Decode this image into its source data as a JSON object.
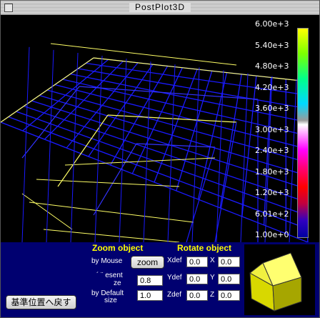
{
  "window": {
    "title": "PostPlot3D"
  },
  "colorbar": {
    "labels": [
      "6.00e+3",
      "5.40e+3",
      "4.80e+3",
      "4.20e+3",
      "3.60e+3",
      "3.00e+3",
      "2.40e+3",
      "1.80e+3",
      "1.20e+3",
      "6.01e+2",
      "1.00e+0"
    ]
  },
  "zoom": {
    "header": "Zoom object",
    "by_mouse_label": "by Mouse",
    "zoom_button": "zoom",
    "present_size_label_1": "´ ¨ esent",
    "present_size_label_2": "ze",
    "present_size_value": "0.8",
    "default_size_label_1": "by Default",
    "default_size_label_2": "size",
    "default_size_value": "1.0"
  },
  "rotate": {
    "header": "Rotate object",
    "xdef_label": "Xdef",
    "xdef_value": "0.0",
    "x_label": "X",
    "x_value": "0.0",
    "ydef_label": "Ydef",
    "ydef_value": "0.0",
    "y_label": "Y",
    "y_value": "0.0",
    "zdef_label": "Zdef",
    "zdef_value": "0.0",
    "z_label": "Z",
    "z_value": "0.0"
  },
  "reset_button": "基準位置へ戻す",
  "colors": {
    "wire": "#1a1aff",
    "contour": "#ffff66",
    "panel_bg": "#000070",
    "header_text": "#ffff00"
  }
}
